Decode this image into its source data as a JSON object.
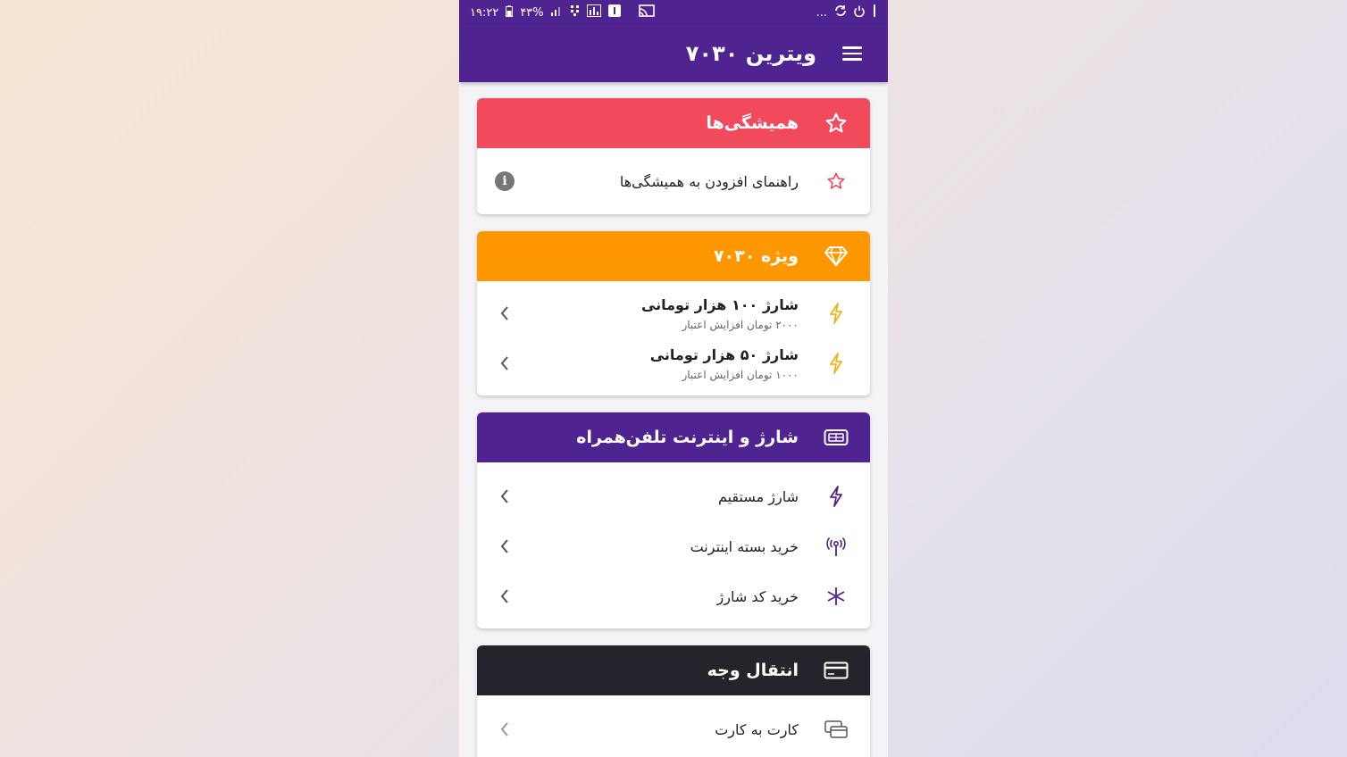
{
  "status_bar": {
    "time": "۱۹:۲۲",
    "battery": "۴۳%",
    "dots": "..."
  },
  "app_bar": {
    "title": "ویترین ۷۰۳۰"
  },
  "colors": {
    "primary": "#4f2390",
    "favorites": "#f24a5d",
    "special": "#ff9800",
    "transfer": "#26232c"
  },
  "favorites": {
    "title": "همیشگی‌ها",
    "header_icon": "star-outline-icon",
    "items": [
      {
        "label": "راهنمای افزودن به همیشگی‌ها",
        "icon": "star-outline-icon",
        "end_icon": "info-icon"
      }
    ]
  },
  "special": {
    "title": "ویژه ۷۰۳۰",
    "header_icon": "diamond-icon",
    "items": [
      {
        "label": "شارژ ۱۰۰ هزار تومانی",
        "sub": "۲۰۰۰ تومان افزایش اعتبار",
        "icon": "lightning-icon"
      },
      {
        "label": "شارژ ۵۰ هزار تومانی",
        "sub": "۱۰۰۰ تومان افزایش اعتبار",
        "icon": "lightning-icon"
      }
    ]
  },
  "mobile": {
    "title": "شارژ و اینترنت تلفن‌همراه",
    "header_icon": "sim-card-icon",
    "items": [
      {
        "label": "شارژ مستقیم",
        "icon": "lightning-icon"
      },
      {
        "label": "خرید بسته اینترنت",
        "icon": "antenna-icon"
      },
      {
        "label": "خرید کد شارژ",
        "icon": "asterisk-icon"
      }
    ]
  },
  "transfer": {
    "title": "انتقال وجه",
    "header_icon": "credit-card-icon",
    "items": [
      {
        "label": "کارت به کارت",
        "icon": "cards-icon"
      }
    ]
  }
}
